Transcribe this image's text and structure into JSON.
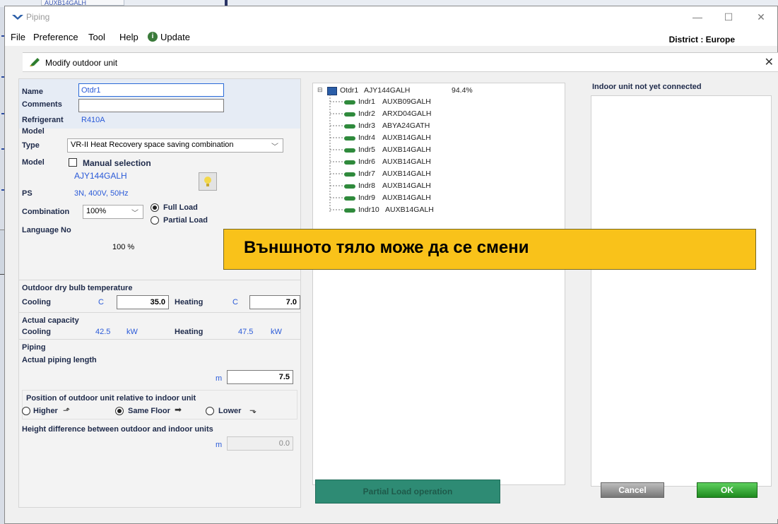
{
  "background": {
    "tab_text": "AUXB14GALH"
  },
  "window": {
    "title": "Piping",
    "controls": {
      "minimize": "—",
      "maximize": "☐",
      "close": "✕"
    }
  },
  "menu": {
    "items": [
      "File",
      "Preference",
      "Tool",
      "Help",
      "Update"
    ],
    "district": "District : Europe"
  },
  "modal": {
    "title": "Modify outdoor unit",
    "close": "✕"
  },
  "form": {
    "name_label": "Name",
    "name_value": "Otdr1",
    "comments_label": "Comments",
    "comments_value": "",
    "refrigerant_label": "Refrigerant",
    "refrigerant_value": "R410A",
    "model_section": "Model",
    "type_label": "Type",
    "type_value": "VR-II Heat Recovery space saving combination",
    "model_label": "Model",
    "manual_selection": "Manual selection",
    "manual_checked": false,
    "model_value": "AJY144GALH",
    "ps_label": "PS",
    "ps_value": "3N, 400V, 50Hz",
    "combination_label": "Combination",
    "combination_value": "100%",
    "full_load": "Full Load",
    "partial_load": "Partial Load",
    "selected_load": "full",
    "language_label": "Language No",
    "ratio_value": "100 %",
    "outdoor_temp_section": "Outdoor dry bulb temperature",
    "cooling_label": "Cooling",
    "heating_label": "Heating",
    "temp_unit": "C",
    "cooling_temp": "35.0",
    "heating_temp": "7.0",
    "actual_capacity_section": "Actual capacity",
    "cooling_capacity": "42.5",
    "heating_capacity": "47.5",
    "capacity_unit": "kW",
    "piping_section": "Piping",
    "actual_piping_length_label": "Actual piping length",
    "length_unit": "m",
    "piping_length": "7.5",
    "position_label": "Position of outdoor unit relative to indoor unit",
    "position_higher": "Higher",
    "position_same": "Same Floor",
    "position_lower": "Lower",
    "selected_position": "same",
    "height_diff_label": "Height difference between outdoor and indoor units",
    "height_diff_value": "0.0"
  },
  "tree": {
    "root": {
      "name": "Otdr1",
      "model": "AJY144GALH",
      "ratio": "94.4%"
    },
    "children": [
      {
        "name": "Indr1",
        "model": "AUXB09GALH"
      },
      {
        "name": "Indr2",
        "model": "ARXD04GALH"
      },
      {
        "name": "Indr3",
        "model": "ABYA24GATH"
      },
      {
        "name": "Indr4",
        "model": "AUXB14GALH"
      },
      {
        "name": "Indr5",
        "model": "AUXB14GALH"
      },
      {
        "name": "Indr6",
        "model": "AUXB14GALH"
      },
      {
        "name": "Indr7",
        "model": "AUXB14GALH"
      },
      {
        "name": "Indr8",
        "model": "AUXB14GALH"
      },
      {
        "name": "Indr9",
        "model": "AUXB14GALH"
      },
      {
        "name": "Indr10",
        "model": "AUXB14GALH"
      }
    ]
  },
  "right_panel": {
    "title": "Indoor unit not yet connected"
  },
  "buttons": {
    "partial_load_operation": "Partial Load operation",
    "cancel": "Cancel",
    "ok": "OK"
  },
  "callout": {
    "text": "Външното тяло може да се смени"
  },
  "colors": {
    "accent": "#2a5ad8",
    "callout": "#f9c21a",
    "ok": "#1e8a1e",
    "partial_button": "#2e8b74"
  }
}
